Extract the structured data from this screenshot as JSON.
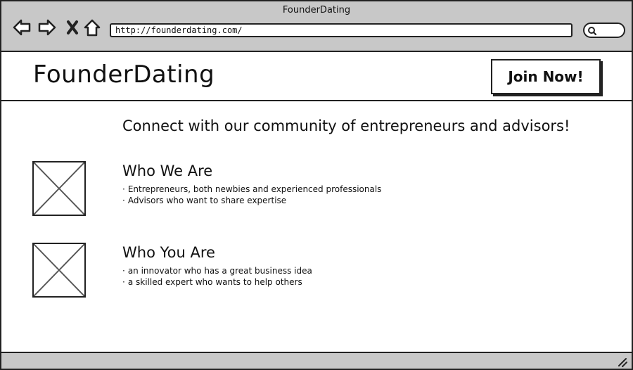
{
  "window": {
    "title": "FounderDating"
  },
  "browser": {
    "url": "http://founderdating.com/",
    "buttons": {
      "back_icon": "back-arrow-icon",
      "forward_icon": "forward-arrow-icon",
      "stop_icon": "close-icon",
      "home_icon": "home-icon",
      "search_icon": "search-icon"
    }
  },
  "header": {
    "logo": "FounderDating",
    "join_label": "Join Now!"
  },
  "main": {
    "tagline": "Connect with our community of entrepreneurs and advisors!",
    "sections": [
      {
        "title": "Who We Are",
        "bullets": [
          "Entrepreneurs, both newbies and experienced professionals",
          "Advisors who want to share expertise"
        ]
      },
      {
        "title": "Who You Are",
        "bullets": [
          "an innovator who has a great business idea",
          "a skilled expert who wants to help others"
        ]
      }
    ]
  },
  "colors": {
    "chrome": "#c8c8c8",
    "stroke": "#222222",
    "background": "#ffffff"
  }
}
